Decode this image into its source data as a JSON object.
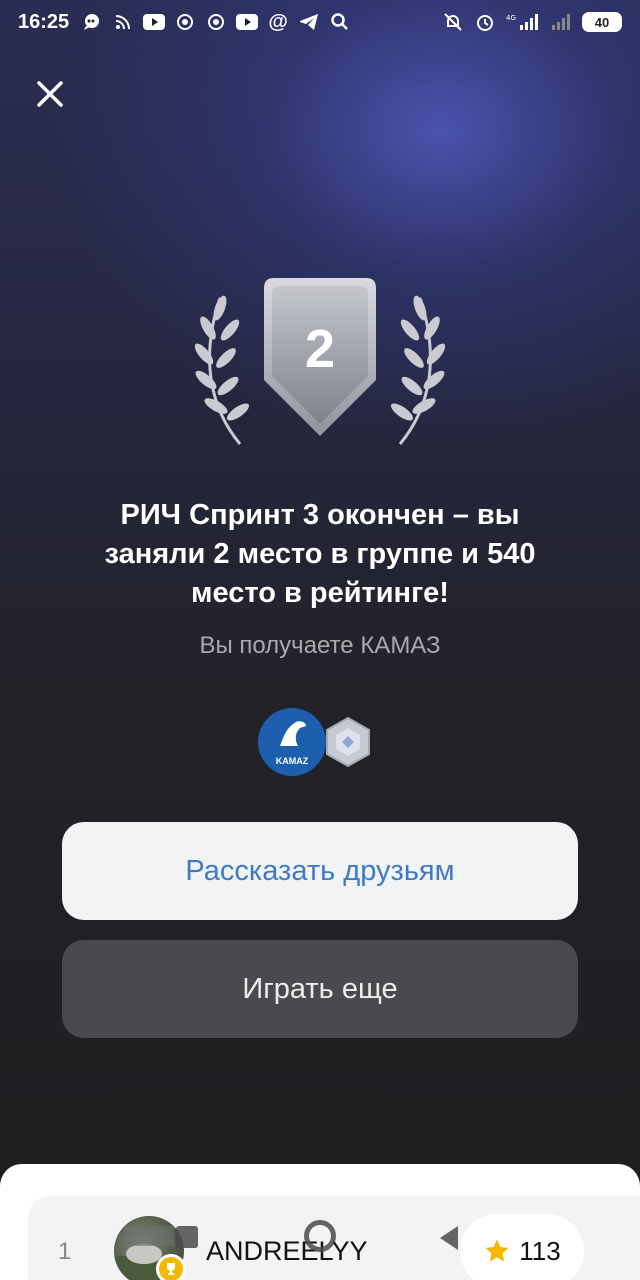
{
  "status_bar": {
    "time": "16:25",
    "network": "4G",
    "battery": "40"
  },
  "medal": {
    "place": "2"
  },
  "result": {
    "headline": "РИЧ Спринт 3 окончен – вы заняли 2 место в группе и 540 место в рейтинге!",
    "reward_text": "Вы получаете КАМАЗ",
    "reward_logo_text": "KAMAZ"
  },
  "buttons": {
    "share_label": "Рассказать друзьям",
    "play_again_label": "Играть еще"
  },
  "leaderboard": {
    "rows": [
      {
        "rank": "1",
        "username": "ANDREELYY",
        "score": "113"
      }
    ]
  },
  "colors": {
    "accent_link": "#3f7ac4",
    "trophy_gold": "#f5b800",
    "star_gold": "#f5b800"
  }
}
